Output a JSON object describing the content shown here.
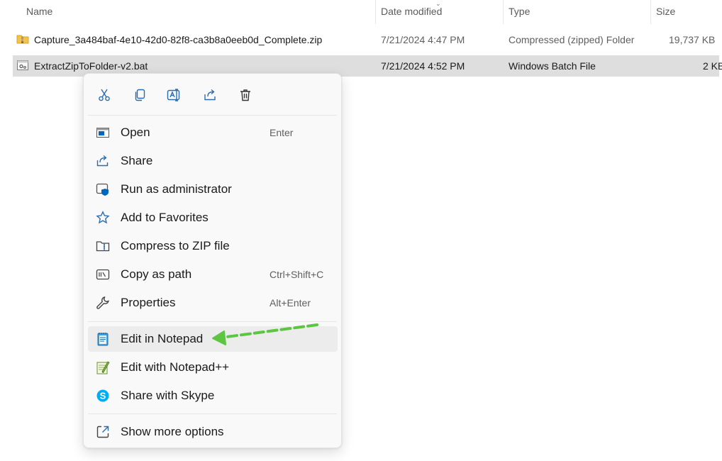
{
  "columns": {
    "name": "Name",
    "date_modified": "Date modified",
    "type": "Type",
    "size": "Size"
  },
  "files": [
    {
      "name": "Capture_3a484baf-4e10-42d0-82f8-ca3b8a0eeb0d_Complete.zip",
      "date": "7/21/2024 4:47 PM",
      "type": "Compressed (zipped) Folder",
      "size": "19,737 KB",
      "icon": "zip-folder-icon",
      "selected": false
    },
    {
      "name": "ExtractZipToFolder-v2.bat",
      "date": "7/21/2024 4:52 PM",
      "type": "Windows Batch File",
      "size": "2 KB",
      "icon": "batch-file-icon",
      "selected": true
    }
  ],
  "context_menu": {
    "quick_actions": [
      "cut-icon",
      "copy-icon",
      "rename-icon",
      "share-icon",
      "delete-icon"
    ],
    "items": [
      {
        "label": "Open",
        "shortcut": "Enter",
        "icon": "open-icon"
      },
      {
        "label": "Share",
        "shortcut": "",
        "icon": "share-icon"
      },
      {
        "label": "Run as administrator",
        "shortcut": "",
        "icon": "shield-icon"
      },
      {
        "label": "Add to Favorites",
        "shortcut": "",
        "icon": "star-icon"
      },
      {
        "label": "Compress to ZIP file",
        "shortcut": "",
        "icon": "zip-icon"
      },
      {
        "label": "Copy as path",
        "shortcut": "Ctrl+Shift+C",
        "icon": "copy-path-icon"
      },
      {
        "label": "Properties",
        "shortcut": "Alt+Enter",
        "icon": "wrench-icon"
      }
    ],
    "app_items": [
      {
        "label": "Edit in Notepad",
        "icon": "notepad-icon",
        "highlighted": true
      },
      {
        "label": "Edit with Notepad++",
        "icon": "notepadpp-icon",
        "highlighted": false
      },
      {
        "label": "Share with Skype",
        "icon": "skype-icon",
        "highlighted": false
      }
    ],
    "more": {
      "label": "Show more options",
      "icon": "expand-icon"
    }
  },
  "colors": {
    "selection": "#dedede",
    "hover": "#ececec",
    "accent": "#0067c0",
    "annotation_arrow": "#5cc640"
  }
}
